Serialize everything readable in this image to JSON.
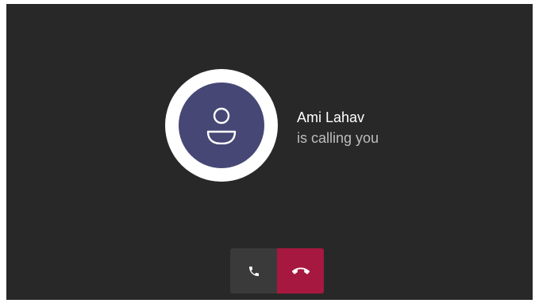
{
  "call": {
    "caller_name": "Ami Lahav",
    "status_text": "is calling you"
  },
  "avatar": {
    "icon": "person-icon",
    "color": "#464775"
  },
  "controls": {
    "accept_icon": "phone-icon",
    "decline_icon": "hang-up-icon",
    "decline_color": "#a6183f"
  },
  "colors": {
    "background": "#292828",
    "accept_button": "#3b3a3a"
  }
}
